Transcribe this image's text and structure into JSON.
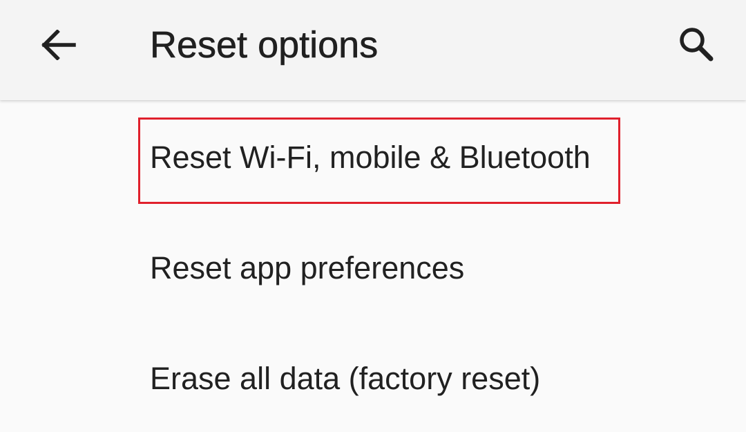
{
  "header": {
    "title": "Reset options",
    "back_icon": "arrow-back-icon",
    "search_icon": "search-icon"
  },
  "options": [
    {
      "label": "Reset Wi-Fi, mobile & Bluetooth"
    },
    {
      "label": "Reset app preferences"
    },
    {
      "label": "Erase all data (factory reset)"
    }
  ],
  "highlight": {
    "target": "Reset Wi-Fi, mobile & Bluetooth",
    "color": "#e0202c"
  },
  "colors": {
    "app_bar": "#f4f4f4",
    "background": "#fafafa",
    "text": "#212121"
  }
}
